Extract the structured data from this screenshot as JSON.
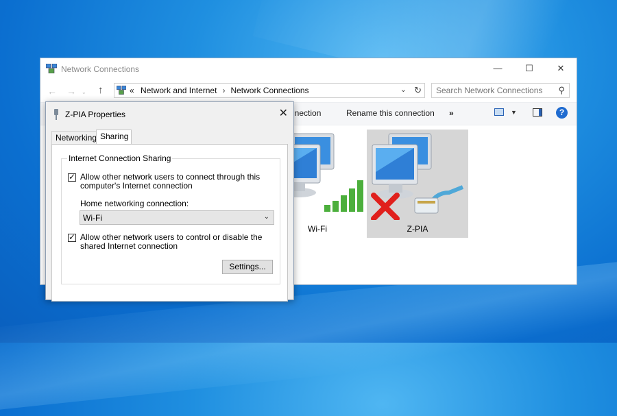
{
  "window": {
    "title": "Network Connections",
    "minimize_glyph": "—",
    "maximize_glyph": "☐",
    "close_glyph": "✕"
  },
  "nav": {
    "back_glyph": "←",
    "forward_glyph": "→",
    "history_glyph": "⌄",
    "up_glyph": "↑"
  },
  "address": {
    "overflow": "«",
    "crumbs": [
      "Network and Internet",
      "Network Connections"
    ],
    "separator": "›",
    "dropdown_glyph": "⌄",
    "refresh_glyph": "↻"
  },
  "search": {
    "placeholder": "Search Network Connections",
    "icon": "search-icon",
    "glyph": "⚲"
  },
  "commandbar": {
    "partial_label": "nnection",
    "rename_label": "Rename this connection",
    "more_label": "»",
    "view_dropdown_glyph": "▼",
    "help_glyph": "?"
  },
  "adapters": [
    {
      "name": "Wi-Fi"
    },
    {
      "name": "Z-PIA"
    }
  ],
  "dialog": {
    "title": "Z-PIA Properties",
    "close_glyph": "✕",
    "tabs": [
      "Networking",
      "Sharing"
    ],
    "active_tab": "Sharing",
    "group_title": "Internet Connection Sharing",
    "option1": {
      "line1": "Allow other network users to connect through this",
      "line2": "computer's Internet connection",
      "checked": true
    },
    "home_label": "Home networking connection:",
    "home_value": "Wi-Fi",
    "select_arrow": "⌄",
    "option2": {
      "line1": "Allow other network users to control or disable the",
      "line2": "shared Internet connection",
      "checked": true
    },
    "settings_button": "Settings..."
  },
  "colors": {
    "accent": "#1f6bd0",
    "selection": "#d6d6d6",
    "error_x": "#e0201c",
    "signal_green": "#4caf3c"
  }
}
